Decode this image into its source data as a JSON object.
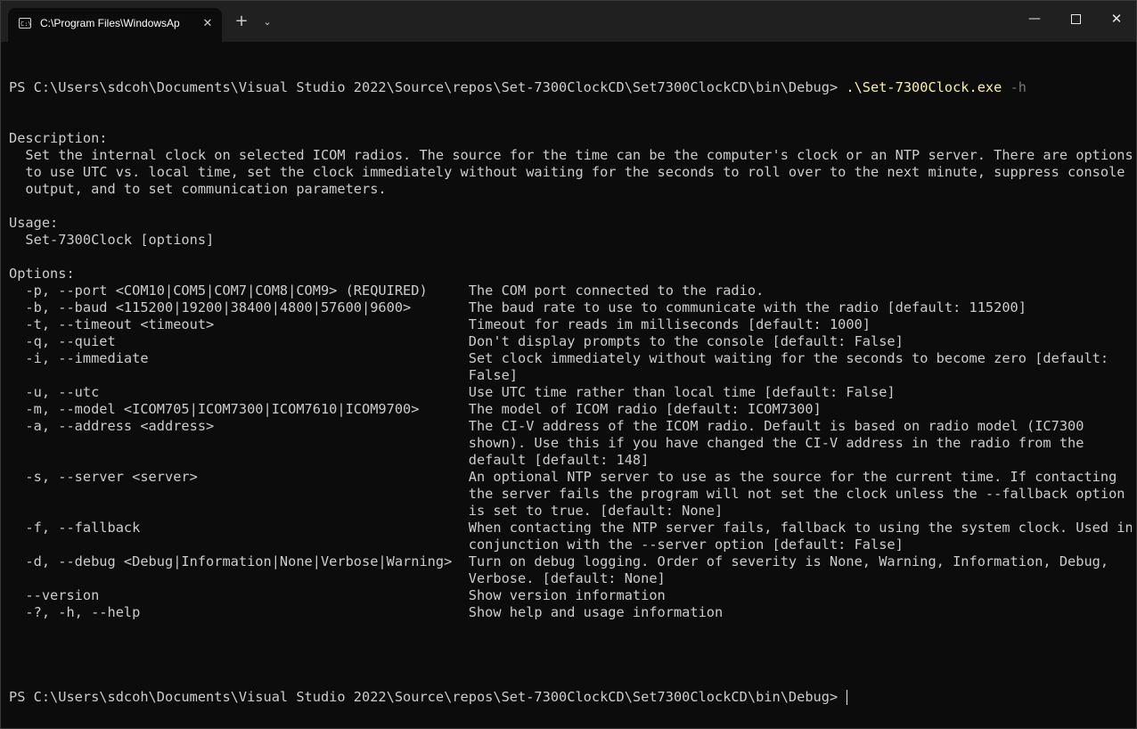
{
  "tab": {
    "title": "C:\\Program Files\\WindowsAp",
    "icon": "terminal-icon"
  },
  "controls": {
    "new_tab": "+",
    "dropdown": "⌄",
    "minimize": "—",
    "close": "✕"
  },
  "terminal": {
    "prompt1": "PS C:\\Users\\sdcoh\\Documents\\Visual Studio 2022\\Source\\repos\\Set-7300ClockCD\\Set7300ClockCD\\bin\\Debug> ",
    "command": ".\\Set-7300Clock.exe",
    "command_arg": " -h",
    "lines": [
      "Description:",
      "  Set the internal clock on selected ICOM radios. The source for the time can be the computer's clock or an NTP server. There are options",
      "  to use UTC vs. local time, set the clock immediately without waiting for the seconds to roll over to the next minute, suppress console",
      "  output, and to set communication parameters.",
      "",
      "Usage:",
      "  Set-7300Clock [options]",
      "",
      "Options:",
      "  -p, --port <COM10|COM5|COM7|COM8|COM9> (REQUIRED)     The COM port connected to the radio.",
      "  -b, --baud <115200|19200|38400|4800|57600|9600>       The baud rate to use to communicate with the radio [default: 115200]",
      "  -t, --timeout <timeout>                               Timeout for reads im milliseconds [default: 1000]",
      "  -q, --quiet                                           Don't display prompts to the console [default: False]",
      "  -i, --immediate                                       Set clock immediately without waiting for the seconds to become zero [default:",
      "                                                        False]",
      "  -u, --utc                                             Use UTC time rather than local time [default: False]",
      "  -m, --model <ICOM705|ICOM7300|ICOM7610|ICOM9700>      The model of ICOM radio [default: ICOM7300]",
      "  -a, --address <address>                               The CI-V address of the ICOM radio. Default is based on radio model (IC7300",
      "                                                        shown). Use this if you have changed the CI-V address in the radio from the",
      "                                                        default [default: 148]",
      "  -s, --server <server>                                 An optional NTP server to use as the source for the current time. If contacting",
      "                                                        the server fails the program will not set the clock unless the --fallback option",
      "                                                        is set to true. [default: None]",
      "  -f, --fallback                                        When contacting the NTP server fails, fallback to using the system clock. Used in",
      "                                                        conjunction with the --server option [default: False]",
      "  -d, --debug <Debug|Information|None|Verbose|Warning>  Turn on debug logging. Order of severity is None, Warning, Information, Debug,",
      "                                                        Verbose. [default: None]",
      "  --version                                             Show version information",
      "  -?, -h, --help                                        Show help and usage information",
      "",
      ""
    ],
    "prompt2": "PS C:\\Users\\sdcoh\\Documents\\Visual Studio 2022\\Source\\repos\\Set-7300ClockCD\\Set7300ClockCD\\bin\\Debug> "
  }
}
